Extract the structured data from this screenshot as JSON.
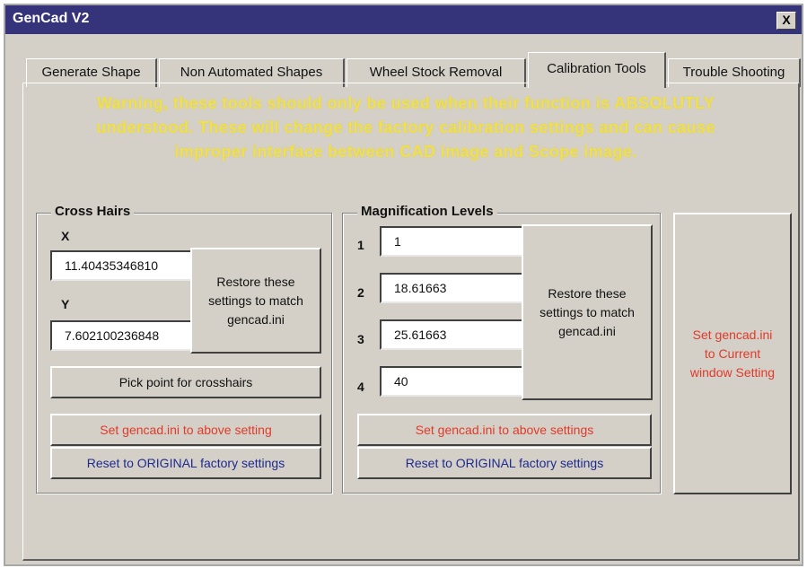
{
  "window": {
    "title": "GenCad V2",
    "close_label": "X"
  },
  "tabs": [
    {
      "label": "Generate Shape",
      "active": false
    },
    {
      "label": "Non Automated Shapes",
      "active": false
    },
    {
      "label": "Wheel Stock Removal",
      "active": false
    },
    {
      "label": "Calibration Tools",
      "active": true
    },
    {
      "label": "Trouble Shooting",
      "active": false
    }
  ],
  "warning": {
    "line1": "Warning,  these tools should only be used when their function is ABSOLUTLY",
    "line2": "understood.  These will change the factory calibration settings and can cause",
    "line3": "improper interface between CAD image and Scope image."
  },
  "cross_hairs": {
    "legend": "Cross Hairs",
    "x_label": "X",
    "x_value": "11.40435346810",
    "y_label": "Y",
    "y_value": "7.602100236848",
    "restore_label": "Restore these settings to match gencad.ini",
    "pick_label": "Pick point for crosshairs",
    "set_label": "Set gencad.ini to above setting",
    "reset_label": "Reset to ORIGINAL factory settings"
  },
  "magnification": {
    "legend": "Magnification Levels",
    "levels": [
      {
        "label": "1",
        "value": "1"
      },
      {
        "label": "2",
        "value": "18.61663"
      },
      {
        "label": "3",
        "value": "25.61663"
      },
      {
        "label": "4",
        "value": "40"
      }
    ],
    "restore_label": "Restore these settings to match gencad.ini",
    "set_label": "Set gencad.ini to above settings",
    "reset_label": "Reset to ORIGINAL factory settings"
  },
  "set_current": {
    "label": "Set gencad.ini to Current window Setting"
  },
  "colors": {
    "titlebar": "#35337a",
    "face": "#d4d0c8",
    "warning": "#f0e04e",
    "red_text": "#e03a2a",
    "blue_text": "#1e2a8e"
  }
}
